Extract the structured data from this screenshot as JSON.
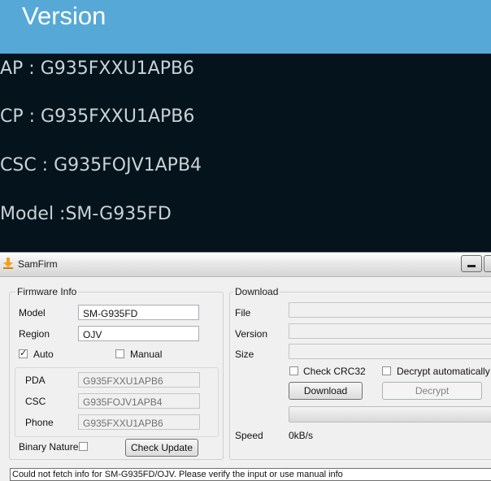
{
  "phone": {
    "title": "Version",
    "lines": [
      "AP : G935FXXU1APB6",
      "CP : G935FXXU1APB6",
      "CSC : G935FOJV1APB4",
      "Model :SM-G935FD"
    ]
  },
  "window": {
    "title": "SamFirm"
  },
  "firmware_info": {
    "legend": "Firmware Info",
    "model_label": "Model",
    "model_value": "SM-G935FD",
    "region_label": "Region",
    "region_value": "OJV",
    "auto_label": "Auto",
    "auto_checked": true,
    "manual_label": "Manual",
    "manual_checked": false,
    "pda_label": "PDA",
    "pda_value": "G935FXXU1APB6",
    "csc_label": "CSC",
    "csc_value": "G935FOJV1APB4",
    "phone_label": "Phone",
    "phone_value": "G935FXXU1APB6",
    "binary_nature_label": "Binary Nature",
    "binary_nature_checked": false,
    "check_update_label": "Check Update"
  },
  "download": {
    "legend": "Download",
    "file_label": "File",
    "version_label": "Version",
    "size_label": "Size",
    "check_crc32_label": "Check CRC32",
    "check_crc32_checked": false,
    "decrypt_auto_label": "Decrypt automatically",
    "decrypt_auto_checked": false,
    "download_button": "Download",
    "decrypt_button": "Decrypt",
    "speed_label": "Speed",
    "speed_value": "0kB/s"
  },
  "status_text": "Could not fetch info for SM-G935FD/OJV. Please verify the input or use manual info",
  "colors": {
    "phone_header": "#56a9d6",
    "phone_background": "#04131c",
    "window_background": "#f0f0f0"
  }
}
